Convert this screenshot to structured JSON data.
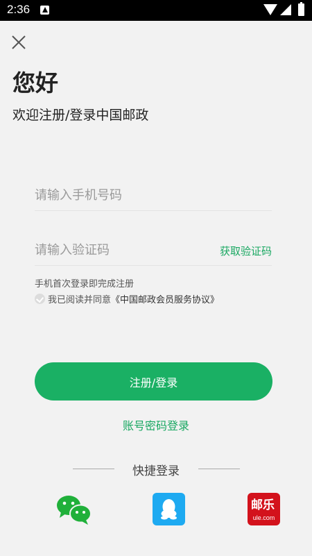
{
  "status_bar": {
    "time": "2:36"
  },
  "header": {
    "title": "您好",
    "subtitle": "欢迎注册/登录中国邮政"
  },
  "form": {
    "phone_placeholder": "请输入手机号码",
    "code_placeholder": "请输入验证码",
    "get_code_label": "获取验证码",
    "hint": "手机首次登录即完成注册",
    "agreement_prefix": "我已阅读并同意",
    "agreement_link": "《中国邮政会员服务协议》",
    "submit_label": "注册/登录",
    "password_login_label": "账号密码登录"
  },
  "quick_login": {
    "label": "快捷登录",
    "providers": [
      {
        "name": "wechat",
        "icon": "wechat-icon"
      },
      {
        "name": "qq",
        "icon": "qq-icon"
      },
      {
        "name": "ule",
        "icon": "ule-logo",
        "text_cn": "邮乐",
        "text_en": "ule.com"
      }
    ]
  },
  "colors": {
    "accent": "#1ab064",
    "background": "#f2f2f2",
    "qq": "#1eaaf1",
    "ule": "#d3121c"
  }
}
